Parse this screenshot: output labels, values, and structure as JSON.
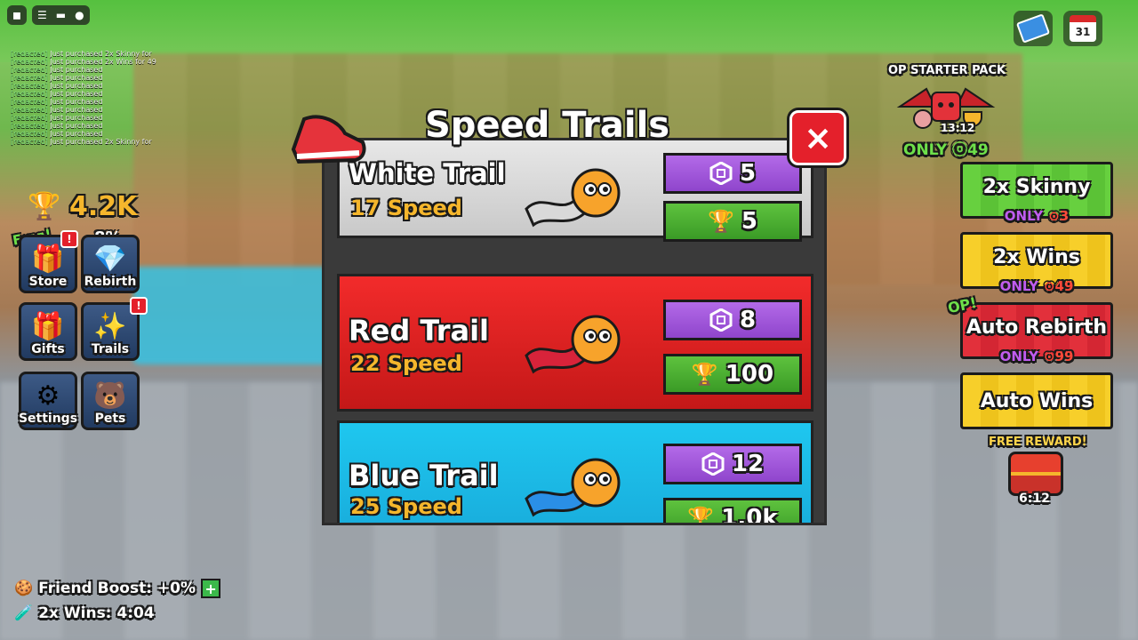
{
  "chat": {
    "lines": [
      {
        "name": "[redacted]",
        "text": "Just purchased 2x Skinny for"
      },
      {
        "name": "[redacted]",
        "text": "Just purchased 2x Wins for 49"
      },
      {
        "name": "[redacted]",
        "text": "Just purchased"
      },
      {
        "name": "[redacted]",
        "text": "Just purchased"
      },
      {
        "name": "[redacted]",
        "text": "Just purchased"
      },
      {
        "name": "[redacted]",
        "text": "Just purchased"
      },
      {
        "name": "[redacted]",
        "text": "Just purchased"
      },
      {
        "name": "[redacted]",
        "text": "Just purchased"
      },
      {
        "name": "[redacted]",
        "text": "Just purchased"
      },
      {
        "name": "[redacted]",
        "text": "Just purchased"
      },
      {
        "name": "[redacted]",
        "text": "Just purchased"
      },
      {
        "name": "[redacted]",
        "text": "Just purchased 2x Skinny for"
      }
    ]
  },
  "hud": {
    "trophies": "4.2K",
    "free_tag": "Free!",
    "rebirth_pct": "8%",
    "alert": "!",
    "buttons": {
      "store": "Store",
      "rebirth": "Rebirth",
      "gifts": "Gifts",
      "trails": "Trails",
      "settings": "Settings",
      "pets": "Pets"
    }
  },
  "status": {
    "friend_boost": "Friend Boost: +0%",
    "plus": "+",
    "wins_timer": "2x Wins: 4:04"
  },
  "top_right": {
    "calendar_day": "31"
  },
  "starter_pack": {
    "title": "OP STARTER PACK",
    "timer": "13:12",
    "price": "ONLY ⓞ49"
  },
  "promos": {
    "skinny": {
      "title": "2x Skinny",
      "only": "ONLY",
      "price": "⊙3"
    },
    "wins": {
      "title": "2x Wins",
      "only": "ONLY",
      "price": "⊙49"
    },
    "op_tag": "OP!",
    "rebirth": {
      "title": "Auto Rebirth",
      "only": "ONLY",
      "price": "⊙99"
    },
    "auto_wins": {
      "title": "Auto Wins"
    },
    "free_reward": "FREE REWARD!",
    "reward_timer": "6:12"
  },
  "modal": {
    "title": "Speed Trails",
    "close": "×",
    "trails": [
      {
        "name": "White Trail",
        "speed": "17 Speed",
        "robux": "5",
        "wins": "5"
      },
      {
        "name": "Red Trail",
        "speed": "22 Speed",
        "robux": "8",
        "wins": "100"
      },
      {
        "name": "Blue Trail",
        "speed": "25 Speed",
        "robux": "12",
        "wins": "1.0k"
      }
    ]
  },
  "colors": {
    "white_card": "#e2e2e2",
    "red_card": "#e62222",
    "blue_card": "#1cb8e6",
    "purple_btn": "#a259dc",
    "green_btn": "#4cae32",
    "gold": "#f5b62c"
  }
}
